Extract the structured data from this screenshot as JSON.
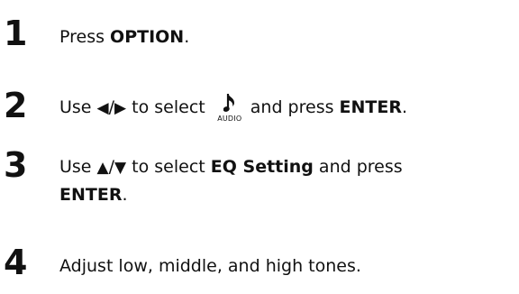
{
  "steps": [
    {
      "number": "1",
      "prefix": "Press ",
      "bold": "OPTION",
      "suffix": "."
    },
    {
      "number": "2",
      "prefix": "Use ",
      "arrow_left": "◀",
      "slash": "/",
      "arrow_right": "▶",
      "middle": " to select ",
      "icon": "music-note-icon",
      "icon_label": "AUDIO",
      "after_icon": "and press ",
      "bold": "ENTER",
      "suffix": "."
    },
    {
      "number": "3",
      "prefix": "Use ",
      "arrow_up": "▲",
      "slash": "/",
      "arrow_down": "▼",
      "middle": " to select ",
      "bold": "EQ Setting",
      "after_bold": " and press",
      "bold2": "ENTER",
      "suffix": "."
    },
    {
      "number": "4",
      "text": "Adjust low, middle, and high tones."
    }
  ]
}
